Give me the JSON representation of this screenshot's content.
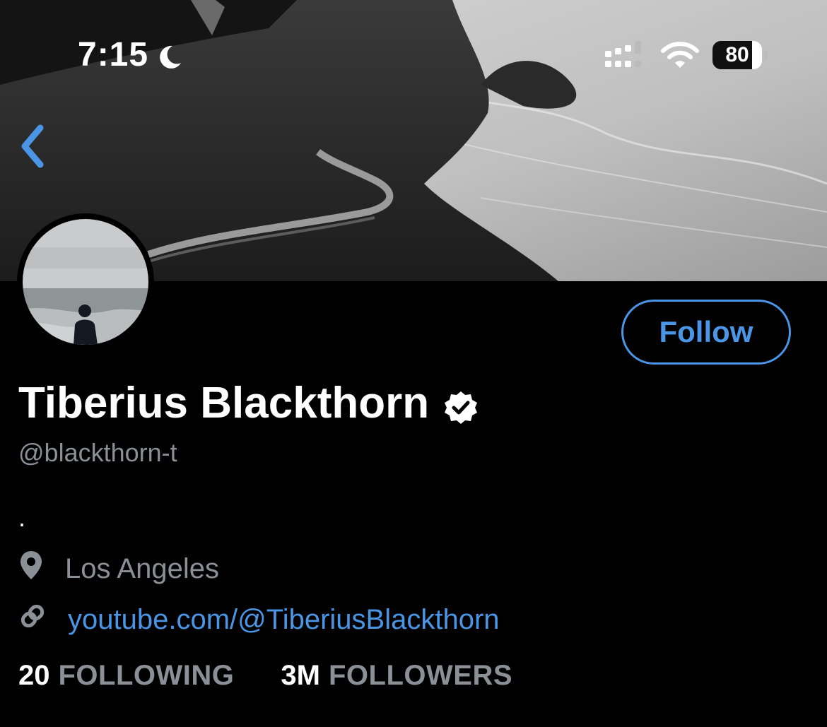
{
  "status_bar": {
    "time": "7:15",
    "battery_level": "80",
    "battery_fraction": 0.8,
    "icons": [
      "moon-icon",
      "signal-icon",
      "wifi-icon",
      "battery-icon"
    ]
  },
  "navigation": {
    "back_icon": "chevron-left-icon"
  },
  "profile": {
    "display_name": "Tiberius Blackthorn",
    "verified_icon": "verified-badge-icon",
    "handle": "@blackthorn-t",
    "bio": ".",
    "location": "Los Angeles",
    "location_icon": "map-pin-icon",
    "website": "youtube.com/@TiberiusBlackthorn",
    "website_icon": "link-icon",
    "follow_label": "Follow"
  },
  "stats": {
    "following_count": "20",
    "following_label": "FOLLOWING",
    "followers_count": "3M",
    "followers_label": "FOLLOWERS"
  },
  "colors": {
    "background": "#000000",
    "accent": "#4a95e6",
    "secondary_text": "#8b9097",
    "primary_text": "#ffffff"
  }
}
